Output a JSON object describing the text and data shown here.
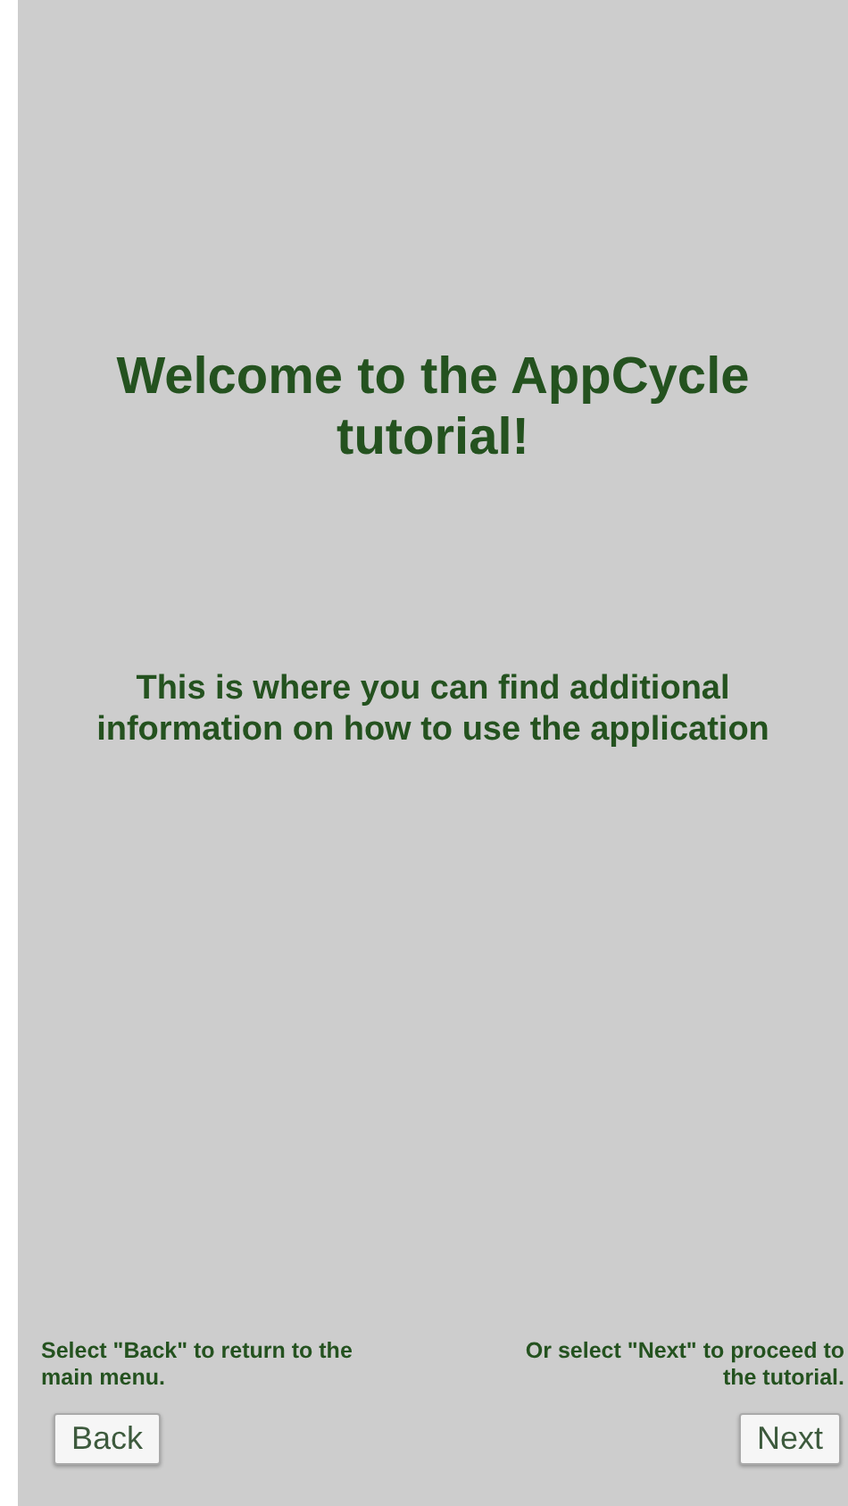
{
  "title": "Welcome to the AppCycle tutorial!",
  "description": "This is where you can find additional information on how to use the application",
  "hints": [
    "Select \"Back\" to return to the main menu.",
    "Or select \"Next\" to proceed to the tutorial."
  ],
  "buttons": [
    "Back",
    "Next"
  ]
}
